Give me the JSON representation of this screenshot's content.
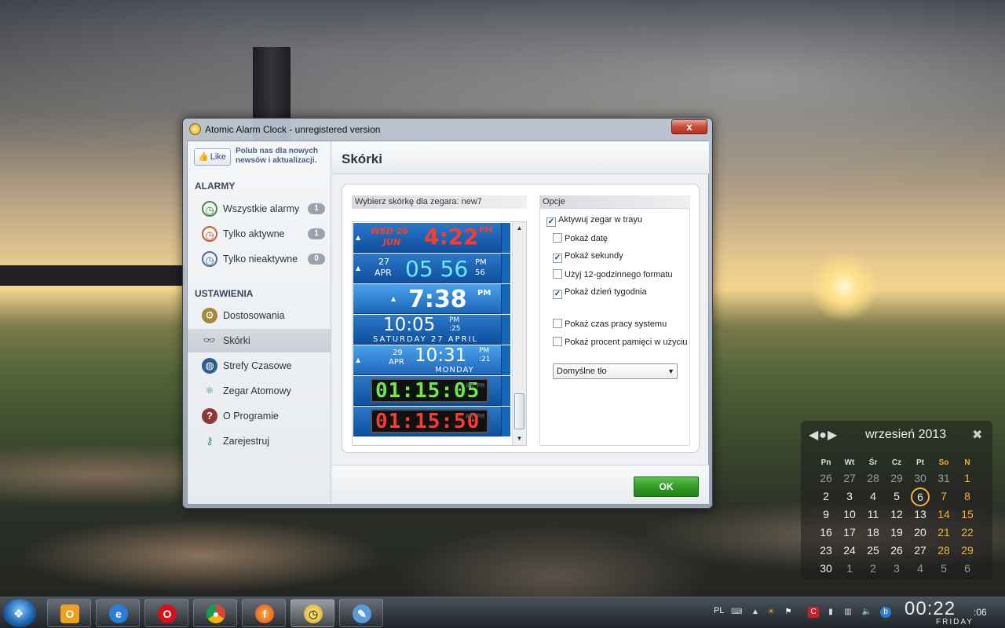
{
  "window": {
    "title": "Atomic Alarm Clock - unregistered version",
    "close_label": "x"
  },
  "sidebar": {
    "like_label": "Like",
    "like_text": "Polub nas dla nowych newsów i aktualizacji.",
    "alarms_heading": "ALARMY",
    "alarms": [
      {
        "label": "Wszystkie alarmy",
        "count": "1"
      },
      {
        "label": "Tylko aktywne",
        "count": "1"
      },
      {
        "label": "Tylko nieaktywne",
        "count": "0"
      }
    ],
    "settings_heading": "USTAWIENIA",
    "settings": [
      {
        "label": "Dostosowania"
      },
      {
        "label": "Skórki"
      },
      {
        "label": "Strefy Czasowe"
      },
      {
        "label": "Zegar Atomowy"
      },
      {
        "label": "O Programie"
      },
      {
        "label": "Zarejestruj"
      }
    ]
  },
  "content": {
    "title": "Skórki",
    "skin_group_label": "Wybierz skórkę dla zegara: new7",
    "options_group_label": "Opcje",
    "skins": [
      {
        "line1": "WED 26",
        "line2": "JUN",
        "time": "4:22",
        "suffix": "PM"
      },
      {
        "line1": "27",
        "line2": "APR",
        "time": "05 56",
        "suffix": "PM 56"
      },
      {
        "time": "7:38",
        "suffix": "PM"
      },
      {
        "time": "10:05",
        "suffix": "PM :25",
        "sub": "SATURDAY 27 APRIL"
      },
      {
        "line1": "29",
        "line2": "APR",
        "time": "10:31",
        "suffix": "PM :21",
        "sub": "MONDAY"
      },
      {
        "time": "01:15:05",
        "suffix": "AM PM",
        "color": "#6ee84a"
      },
      {
        "time": "01:15:50",
        "suffix": "AM PM",
        "color": "#ff3b2a"
      }
    ],
    "options": [
      {
        "label": "Aktywuj zegar w trayu",
        "checked": true
      },
      {
        "label": "Pokaż datę",
        "checked": false
      },
      {
        "label": "Pokaż sekundy",
        "checked": true
      },
      {
        "label": "Użyj 12-godzinnego formatu",
        "checked": false
      },
      {
        "label": "Pokaż dzień tygodnia",
        "checked": true
      },
      {
        "label": "Pokaż czas pracy systemu",
        "checked": false
      },
      {
        "label": "Pokaż procent pamięci w użyciu",
        "checked": false
      }
    ],
    "background_select": "Domyślne tło",
    "ok_label": "OK"
  },
  "calendar": {
    "month": "wrzesień 2013",
    "weekdays": [
      "Pn",
      "Wt",
      "Śr",
      "Cz",
      "Pt",
      "So",
      "N"
    ],
    "weeks": [
      [
        "26",
        "27",
        "28",
        "29",
        "30",
        "31",
        "1"
      ],
      [
        "2",
        "3",
        "4",
        "5",
        "6",
        "7",
        "8"
      ],
      [
        "9",
        "10",
        "11",
        "12",
        "13",
        "14",
        "15"
      ],
      [
        "16",
        "17",
        "18",
        "19",
        "20",
        "21",
        "22"
      ],
      [
        "23",
        "24",
        "25",
        "26",
        "27",
        "28",
        "29"
      ],
      [
        "30",
        "1",
        "2",
        "3",
        "4",
        "5",
        "6"
      ]
    ],
    "today": "6"
  },
  "taskbar": {
    "language": "PL",
    "clock_hm": "00:22",
    "clock_sec": ":06",
    "clock_day": "FRIDAY"
  },
  "colors": {
    "accent_green": "#2e9824",
    "weekend": "#f2b23a",
    "close_red": "#c94c37"
  }
}
